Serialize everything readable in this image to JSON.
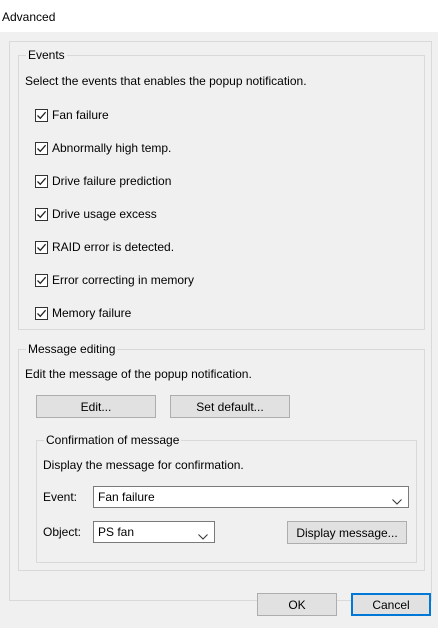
{
  "window": {
    "title": "Advanced"
  },
  "events": {
    "group_label": "Events",
    "description": "Select the events that enables the popup notification.",
    "items": [
      {
        "label": "Fan failure",
        "checked": true
      },
      {
        "label": "Abnormally high temp.",
        "checked": true
      },
      {
        "label": "Drive failure prediction",
        "checked": true
      },
      {
        "label": "Drive usage excess",
        "checked": true
      },
      {
        "label": "RAID error is detected.",
        "checked": true
      },
      {
        "label": "Error correcting in memory",
        "checked": true
      },
      {
        "label": "Memory failure",
        "checked": true
      }
    ]
  },
  "message_editing": {
    "group_label": "Message editing",
    "description": "Edit the message of the popup notification.",
    "edit_button": "Edit...",
    "set_default_button": "Set default..."
  },
  "confirmation": {
    "group_label": "Confirmation of message",
    "description": "Display the message for confirmation.",
    "event_label": "Event:",
    "event_value": "Fan failure",
    "object_label": "Object:",
    "object_value": "PS fan",
    "display_button": "Display message..."
  },
  "footer": {
    "ok": "OK",
    "cancel": "Cancel"
  }
}
